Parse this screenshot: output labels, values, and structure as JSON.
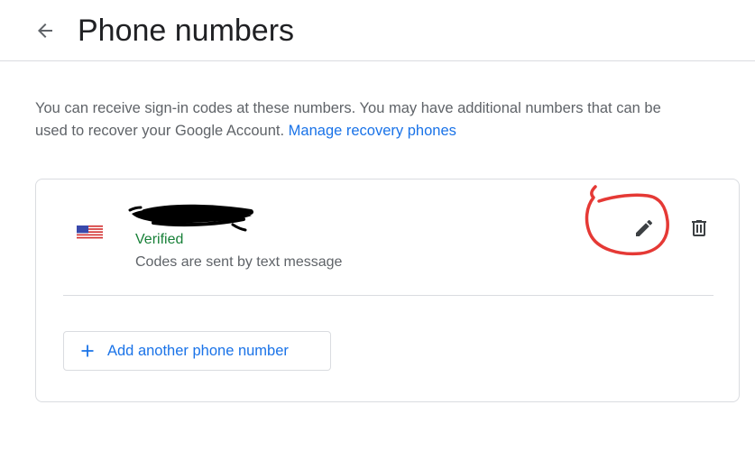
{
  "header": {
    "title": "Phone numbers",
    "back_icon": "arrow-back-icon"
  },
  "intro": {
    "text": "You can receive sign-in codes at these numbers. You may have additional numbers that can be used to recover your Google Account.",
    "link_label": "Manage recovery phones"
  },
  "phone_entry": {
    "country_flag_icon": "us-flag-icon",
    "status": "Verified",
    "method": "Codes are sent by text message",
    "edit_icon": "pencil-icon",
    "delete_icon": "trash-icon"
  },
  "add_button": {
    "icon": "plus-icon",
    "label": "Add another phone number"
  },
  "colors": {
    "link": "#1a73e8",
    "verified": "#188038",
    "annotation": "#e53935",
    "border": "#dadce0"
  }
}
